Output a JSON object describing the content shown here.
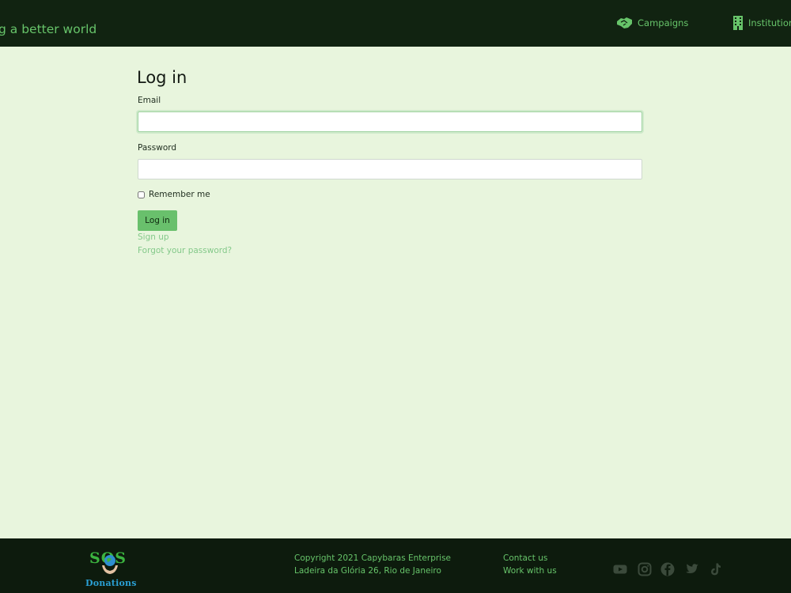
{
  "header": {
    "tagline": "g a better world",
    "nav": [
      {
        "label": "Campaigns",
        "icon": "handshake-icon"
      },
      {
        "label": "Institution",
        "icon": "building-icon"
      }
    ]
  },
  "form": {
    "title": "Log in",
    "email_label": "Email",
    "email_value": "",
    "password_label": "Password",
    "password_value": "",
    "remember_label": "Remember me",
    "remember_checked": false,
    "submit_label": "Log in",
    "signup_link": "Sign up",
    "forgot_link": "Forgot your password?"
  },
  "footer": {
    "logo_top": "SOS",
    "logo_bottom": "Donations",
    "copyright": "Copyright 2021 Capybaras Enterprise",
    "address": "Ladeira da Glória 26, Rio de Janeiro",
    "contact": "Contact us",
    "work": "Work with us",
    "social": [
      "youtube-icon",
      "instagram-icon",
      "facebook-icon",
      "twitter-icon",
      "tiktok-icon"
    ]
  },
  "colors": {
    "header_bg": "#112311",
    "accent": "#67c46a",
    "page_bg": "#e8f5dd",
    "button_bg": "#69c06c",
    "footer_bg": "#0d1b0d",
    "social_icon": "#3b4a3b"
  }
}
